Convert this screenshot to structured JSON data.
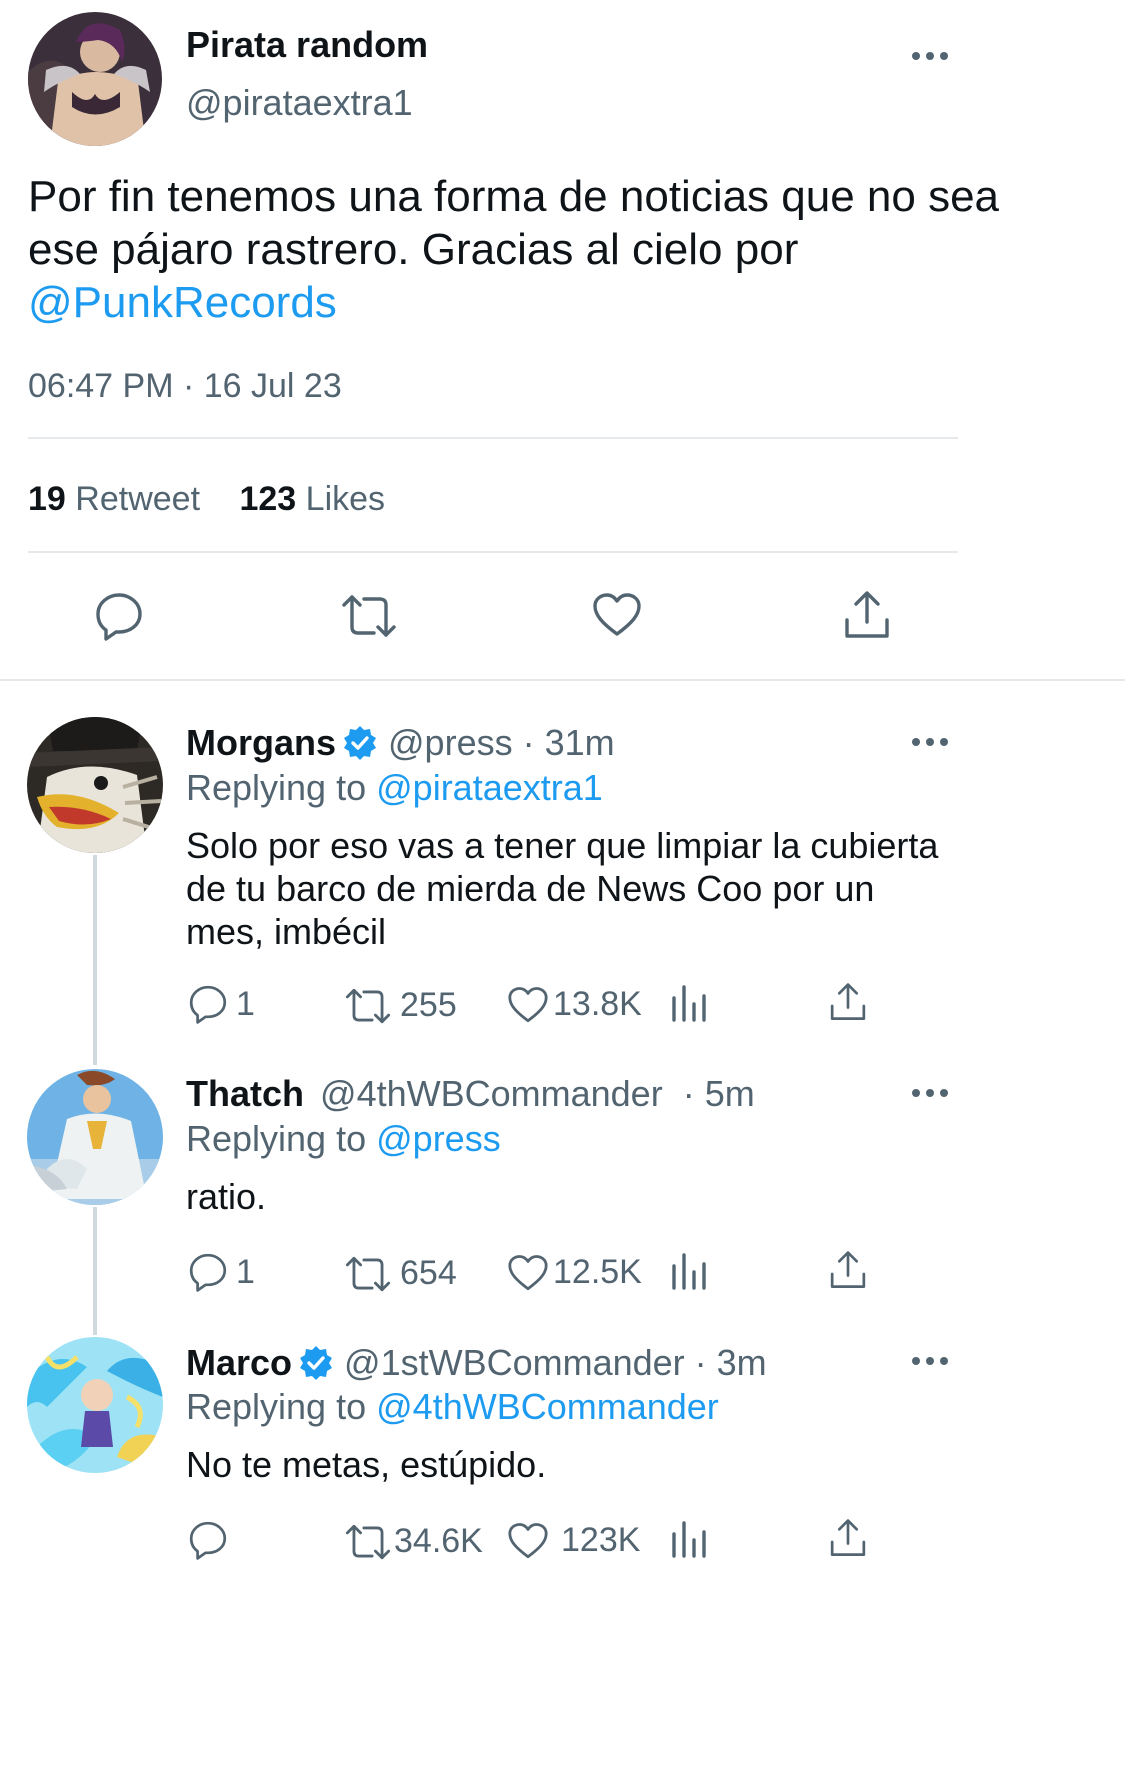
{
  "main_tweet": {
    "display_name": "Pirata random",
    "handle": "@pirataextra1",
    "text": "Por fin tenemos una forma de noticias que no sea ese pájaro rastrero. Gracias al cielo por",
    "mention": "@PunkRecords",
    "timestamp": "06:47 PM · 16 Jul 23",
    "retweet_count": "19",
    "retweet_label": "Retweet",
    "like_count": "123",
    "like_label": "Likes",
    "actions": [
      "reply-icon",
      "retweet-icon",
      "like-icon",
      "share-icon"
    ]
  },
  "replies": [
    {
      "display_name": "Morgans",
      "verified": true,
      "handle": "@press",
      "time": "· 31m",
      "replying_label": "Replying to",
      "replying_to": "@pirataextra1",
      "text": "Solo por eso vas a tener que limpiar la cubierta de tu barco de mierda de News Coo por un mes, imbécil",
      "reply_count": "1",
      "retweet_count": "255",
      "like_count": "13.8K"
    },
    {
      "display_name": "Thatch",
      "verified": false,
      "handle": "@4thWBCommander",
      "time": "· 5m",
      "replying_label": "Replying to",
      "replying_to": "@press",
      "text": "ratio.",
      "reply_count": "1",
      "retweet_count": "654",
      "like_count": "12.5K"
    },
    {
      "display_name": "Marco",
      "verified": true,
      "handle": "@1stWBCommander",
      "time": "· 3m",
      "replying_label": "Replying to",
      "replying_to": "@4thWBCommander",
      "text": "No te metas, estúpido.",
      "reply_count": "",
      "retweet_count": "34.6K",
      "like_count": "123K"
    }
  ],
  "colors": {
    "accent": "#1d9bf0",
    "secondary_text": "#536471",
    "text": "#0f1419",
    "divider": "#e6e9eb"
  }
}
